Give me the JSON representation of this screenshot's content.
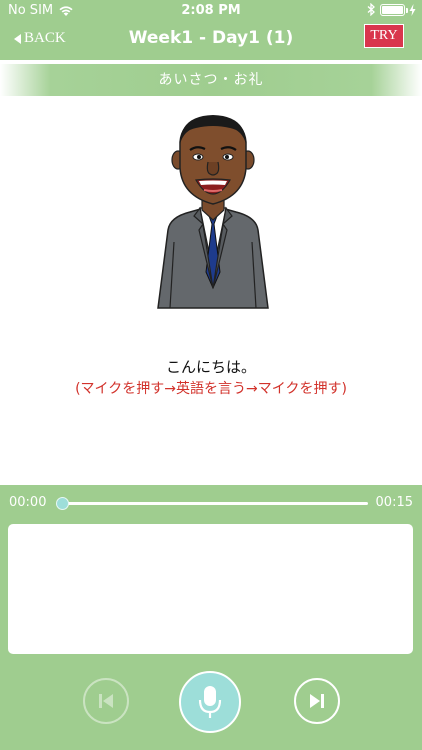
{
  "status_bar": {
    "carrier": "No SIM",
    "time": "2:08 PM"
  },
  "nav": {
    "back_label": "BACK",
    "title": "Week1 - Day1 (1)",
    "try_label": "TRY"
  },
  "category": "あいさつ・お礼",
  "phrase": "こんにちは。",
  "instruction": "(マイクを押す→英語を言う→マイクを押す)",
  "player": {
    "current_time": "00:00",
    "total_time": "00:15",
    "progress": 0.0,
    "transcript": ""
  },
  "icons": {
    "wifi": "wifi-icon",
    "bluetooth": "bluetooth-icon",
    "battery": "battery-icon",
    "prev": "skip-previous-icon",
    "mic": "microphone-icon",
    "next": "skip-next-icon"
  },
  "colors": {
    "theme_green": "#9fcd8f",
    "try_red": "#d9364d",
    "mic_teal": "#9dded9",
    "instruction_red": "#d2322b"
  }
}
